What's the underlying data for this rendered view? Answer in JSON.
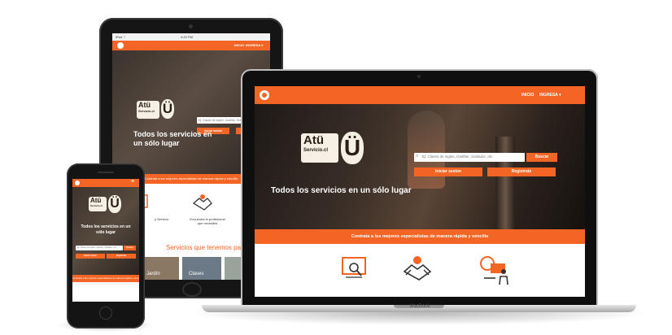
{
  "colors": {
    "brand_orange": "#f26524",
    "dark_bg": "#141414",
    "logo_cream": "#f5efe4"
  },
  "brand": {
    "line1": "Atü",
    "line2": "Servicio.cl",
    "symbol": "Ü"
  },
  "nav": {
    "inicio": "INICIO",
    "ingresa": "INGRESA ▾"
  },
  "hero": {
    "headline": "Todos los servicios en un sólo lugar",
    "search_placeholder": "Ej: Clases de ingles, Gasfiter, Soldador, etc.",
    "search_button": "Buscar",
    "login_button": "Iniciar sesion",
    "register_button": "Registrate"
  },
  "band_text": "Contrata a los mejores especialistas de manera rápida y sencilla",
  "tablet": {
    "status_left": "iPad ⌔",
    "status_time": "4:20 PM",
    "step_text_1": "y Servicio",
    "step_text_2": "Encuentra el profesional que necesites",
    "section_title": "Servicios que tenemos para",
    "card_1": "Jardín",
    "card_2": "Clases"
  },
  "laptop_brand": "MacBook",
  "icons": [
    "search-web-icon",
    "handshake-icon",
    "person-laptop-icon",
    "menu-icon"
  ]
}
